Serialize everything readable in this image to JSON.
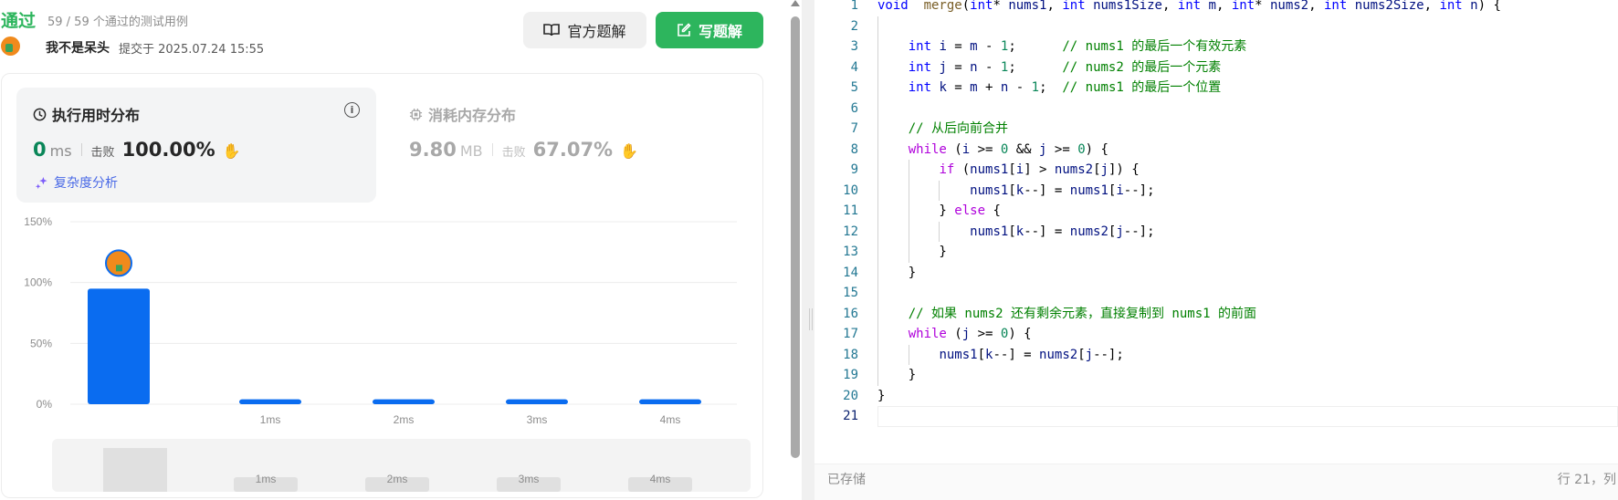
{
  "submission": {
    "status": "通过",
    "tests": "59 / 59 个通过的测试用例",
    "username": "我不是呆头",
    "submitted": "提交于 2025.07.24 15:55"
  },
  "buttons": {
    "official": "官方题解",
    "write": "写题解"
  },
  "runtime": {
    "title": "执行用时分布",
    "value": "0",
    "unit": "ms",
    "beat_label": "击败",
    "beat_pct": "100.00%",
    "complexity": "复杂度分析"
  },
  "memory": {
    "title": "消耗内存分布",
    "value": "9.80",
    "unit": "MB",
    "beat_label": "击败",
    "beat_pct": "67.07%"
  },
  "chart_data": {
    "type": "bar",
    "y_ticks": [
      "150%",
      "100%",
      "50%",
      "0%"
    ],
    "ylim": [
      0,
      150
    ],
    "categories": [
      "",
      "1ms",
      "2ms",
      "3ms",
      "4ms"
    ],
    "values": [
      95,
      4,
      4,
      4,
      4
    ],
    "highlight_index": 0,
    "grid": true,
    "bar_color": "#0a6cf0",
    "overview_labels": [
      "1ms",
      "2ms",
      "3ms",
      "4ms"
    ]
  },
  "editor": {
    "lines": [
      [
        [
          "kw",
          "void"
        ],
        [
          "",
          "  "
        ],
        [
          "fn",
          "merge"
        ],
        [
          "",
          "("
        ],
        [
          "kw",
          "int"
        ],
        [
          "",
          "* "
        ],
        [
          "var",
          "nums1"
        ],
        [
          "",
          ", "
        ],
        [
          "kw",
          "int"
        ],
        [
          "",
          ""
        ],
        [
          "var",
          " nums1Size"
        ],
        [
          "",
          ", "
        ],
        [
          "kw",
          "int"
        ],
        [
          "var",
          " m"
        ],
        [
          "",
          ", "
        ],
        [
          "kw",
          "int"
        ],
        [
          "",
          "* "
        ],
        [
          "var",
          "nums2"
        ],
        [
          "",
          ", "
        ],
        [
          "kw",
          "int"
        ],
        [
          "var",
          " nums2Size"
        ],
        [
          "",
          ", "
        ],
        [
          "kw",
          "int"
        ],
        [
          "var",
          " n"
        ],
        [
          "",
          ") {"
        ]
      ],
      [],
      [
        [
          "",
          "    "
        ],
        [
          "kw",
          "int"
        ],
        [
          "var",
          " i"
        ],
        [
          "",
          " = "
        ],
        [
          "var",
          "m"
        ],
        [
          "",
          " - "
        ],
        [
          "num",
          "1"
        ],
        [
          "",
          ";      "
        ],
        [
          "cm",
          "// nums1 的最后一个有效元素"
        ]
      ],
      [
        [
          "",
          "    "
        ],
        [
          "kw",
          "int"
        ],
        [
          "var",
          " j"
        ],
        [
          "",
          " = "
        ],
        [
          "var",
          "n"
        ],
        [
          "",
          " - "
        ],
        [
          "num",
          "1"
        ],
        [
          "",
          ";      "
        ],
        [
          "cm",
          "// nums2 的最后一个元素"
        ]
      ],
      [
        [
          "",
          "    "
        ],
        [
          "kw",
          "int"
        ],
        [
          "var",
          " k"
        ],
        [
          "",
          " = "
        ],
        [
          "var",
          "m"
        ],
        [
          "",
          " + "
        ],
        [
          "var",
          "n"
        ],
        [
          "",
          " - "
        ],
        [
          "num",
          "1"
        ],
        [
          "",
          ";  "
        ],
        [
          "cm",
          "// nums1 的最后一个位置"
        ]
      ],
      [],
      [
        [
          "",
          "    "
        ],
        [
          "cm",
          "// 从后向前合并"
        ]
      ],
      [
        [
          "",
          "    "
        ],
        [
          "ctl",
          "while"
        ],
        [
          "",
          " ("
        ],
        [
          "var",
          "i"
        ],
        [
          "",
          " >= "
        ],
        [
          "num",
          "0"
        ],
        [
          "",
          " && "
        ],
        [
          "var",
          "j"
        ],
        [
          "",
          " >= "
        ],
        [
          "num",
          "0"
        ],
        [
          "",
          ") {"
        ]
      ],
      [
        [
          "",
          "        "
        ],
        [
          "ctl",
          "if"
        ],
        [
          "",
          " ("
        ],
        [
          "var",
          "nums1"
        ],
        [
          "",
          "["
        ],
        [
          "var",
          "i"
        ],
        [
          "",
          "] > "
        ],
        [
          "var",
          "nums2"
        ],
        [
          "",
          "["
        ],
        [
          "var",
          "j"
        ],
        [
          "",
          "]) {"
        ]
      ],
      [
        [
          "",
          "            "
        ],
        [
          "var",
          "nums1"
        ],
        [
          "",
          "["
        ],
        [
          "var",
          "k"
        ],
        [
          "",
          "--] = "
        ],
        [
          "var",
          "nums1"
        ],
        [
          "",
          "["
        ],
        [
          "var",
          "i"
        ],
        [
          "",
          "--];"
        ]
      ],
      [
        [
          "",
          "        } "
        ],
        [
          "ctl",
          "else"
        ],
        [
          "",
          " {"
        ]
      ],
      [
        [
          "",
          "            "
        ],
        [
          "var",
          "nums1"
        ],
        [
          "",
          "["
        ],
        [
          "var",
          "k"
        ],
        [
          "",
          "--] = "
        ],
        [
          "var",
          "nums2"
        ],
        [
          "",
          "["
        ],
        [
          "var",
          "j"
        ],
        [
          "",
          "--];"
        ]
      ],
      [
        [
          "",
          "        }"
        ]
      ],
      [
        [
          "",
          "    }"
        ]
      ],
      [],
      [
        [
          "",
          "    "
        ],
        [
          "cm",
          "// 如果 nums2 还有剩余元素，直接复制到 nums1 的前面"
        ]
      ],
      [
        [
          "",
          "    "
        ],
        [
          "ctl",
          "while"
        ],
        [
          "",
          " ("
        ],
        [
          "var",
          "j"
        ],
        [
          "",
          " >= "
        ],
        [
          "num",
          "0"
        ],
        [
          "",
          ") {"
        ]
      ],
      [
        [
          "",
          "        "
        ],
        [
          "var",
          "nums1"
        ],
        [
          "",
          "["
        ],
        [
          "var",
          "k"
        ],
        [
          "",
          "--] = "
        ],
        [
          "var",
          "nums2"
        ],
        [
          "",
          "["
        ],
        [
          "var",
          "j"
        ],
        [
          "",
          "--];"
        ]
      ],
      [
        [
          "",
          "    }"
        ]
      ],
      [
        [
          "",
          "}"
        ]
      ],
      []
    ],
    "current_line": 21,
    "saved": "已存储",
    "position": "行 21，列"
  }
}
